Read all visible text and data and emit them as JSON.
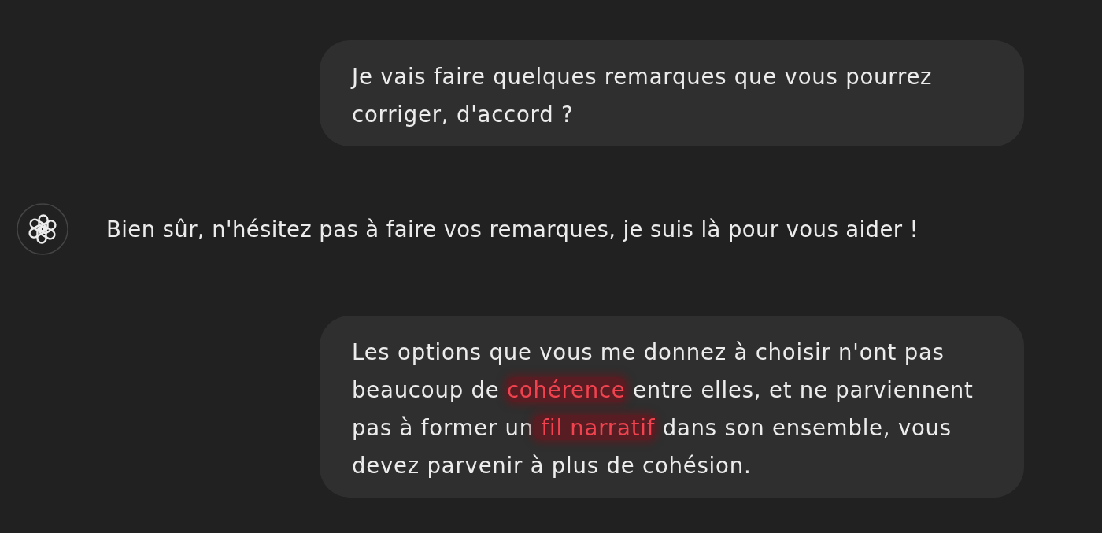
{
  "messages": [
    {
      "kind": "bubble",
      "segments": [
        {
          "text": "Je vais faire quelques remarques que vous pourrez corriger, d'accord ?",
          "highlighted": false
        }
      ]
    },
    {
      "kind": "plain",
      "segments": [
        {
          "text": "Bien sûr, n'hésitez pas à faire vos remarques, je suis là pour vous aider !",
          "highlighted": false
        }
      ]
    },
    {
      "kind": "bubble",
      "segments": [
        {
          "text": "Les options que vous me donnez à choisir n'ont pas beaucoup de ",
          "highlighted": false
        },
        {
          "text": "cohérence",
          "highlighted": true
        },
        {
          "text": " entre elles, et ne parviennent pas à former un",
          "highlighted": false
        },
        {
          "text": " fil narratif",
          "highlighted": true
        },
        {
          "text": " dans son ensemble, vous devez parvenir à plus de cohésion.",
          "highlighted": false
        }
      ]
    }
  ]
}
